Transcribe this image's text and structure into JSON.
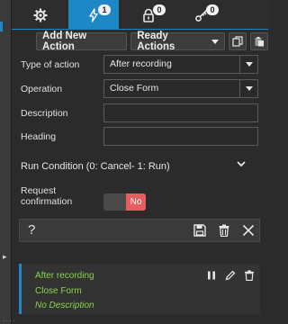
{
  "tabs": [
    {
      "name": "settings",
      "icon": "gear-icon",
      "badge": ""
    },
    {
      "name": "actions",
      "icon": "lightning-icon",
      "badge": "1"
    },
    {
      "name": "locks",
      "icon": "lock-icon",
      "badge": "0"
    },
    {
      "name": "keys",
      "icon": "key-icon",
      "badge": "0"
    }
  ],
  "toolbar": {
    "add_new_action": "Add New Action",
    "ready_actions": "Ready Actions"
  },
  "form": {
    "type_label": "Type of action",
    "type_value": "After recording",
    "operation_label": "Operation",
    "operation_value": "Close Form",
    "description_label": "Description",
    "description_value": "",
    "heading_label": "Heading",
    "heading_value": "",
    "run_condition_label": "Run Condition (0: Cancel- 1: Run)",
    "request_confirmation_label_1": "Request",
    "request_confirmation_label_2": "confirmation",
    "toggle_value": "No"
  },
  "action_bar": {
    "help": "?"
  },
  "item": {
    "type": "After recording",
    "operation": "Close Form",
    "description": "No Description"
  },
  "colors": {
    "accent": "#1e88c7",
    "toggle_off": "#e85d5d",
    "item_text": "#8ad14a"
  }
}
